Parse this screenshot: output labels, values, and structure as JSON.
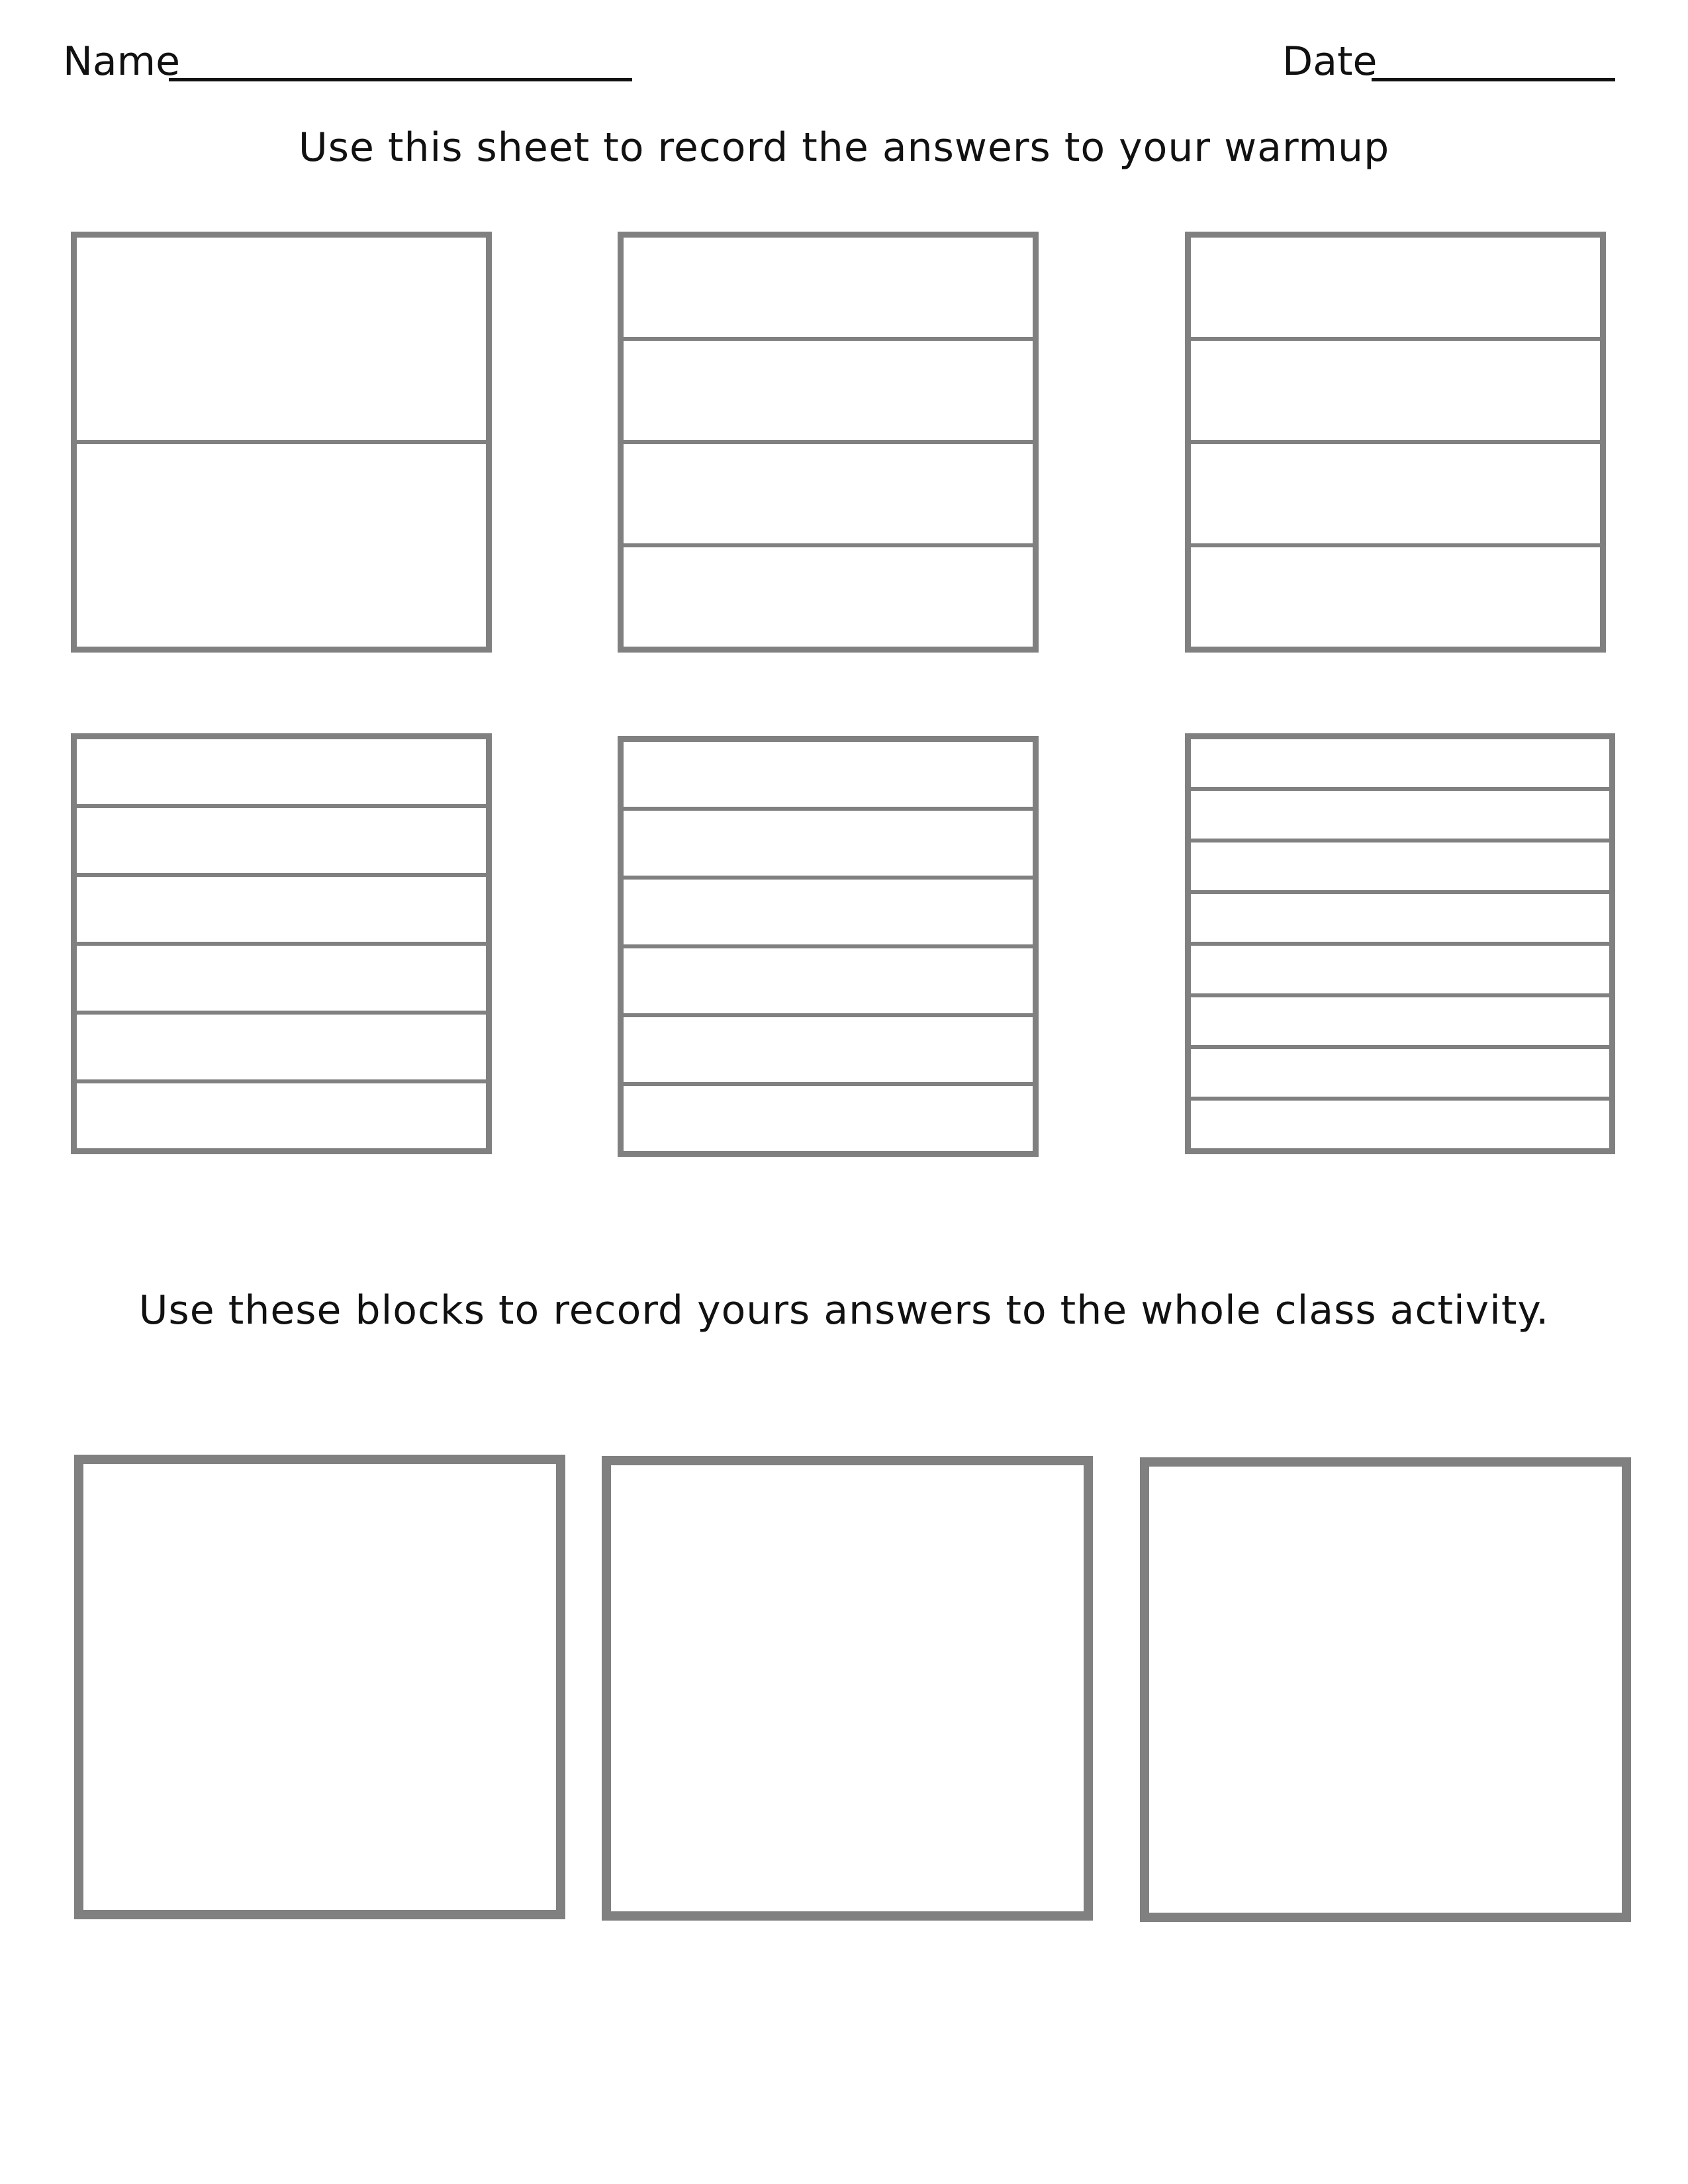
{
  "header": {
    "name_label": "Name",
    "date_label": "Date"
  },
  "instructions": {
    "warmup": "Use this sheet to record the answers to your warmup",
    "class_activity": "Use these blocks to record yours answers to the whole class activity."
  },
  "warmup_boxes": [
    {
      "strips": 2
    },
    {
      "strips": 4
    },
    {
      "strips": 4
    },
    {
      "strips": 6
    },
    {
      "strips": 6
    },
    {
      "strips": 8
    }
  ],
  "answer_blocks": 3,
  "colors": {
    "border": "#808080",
    "text": "#111111"
  }
}
